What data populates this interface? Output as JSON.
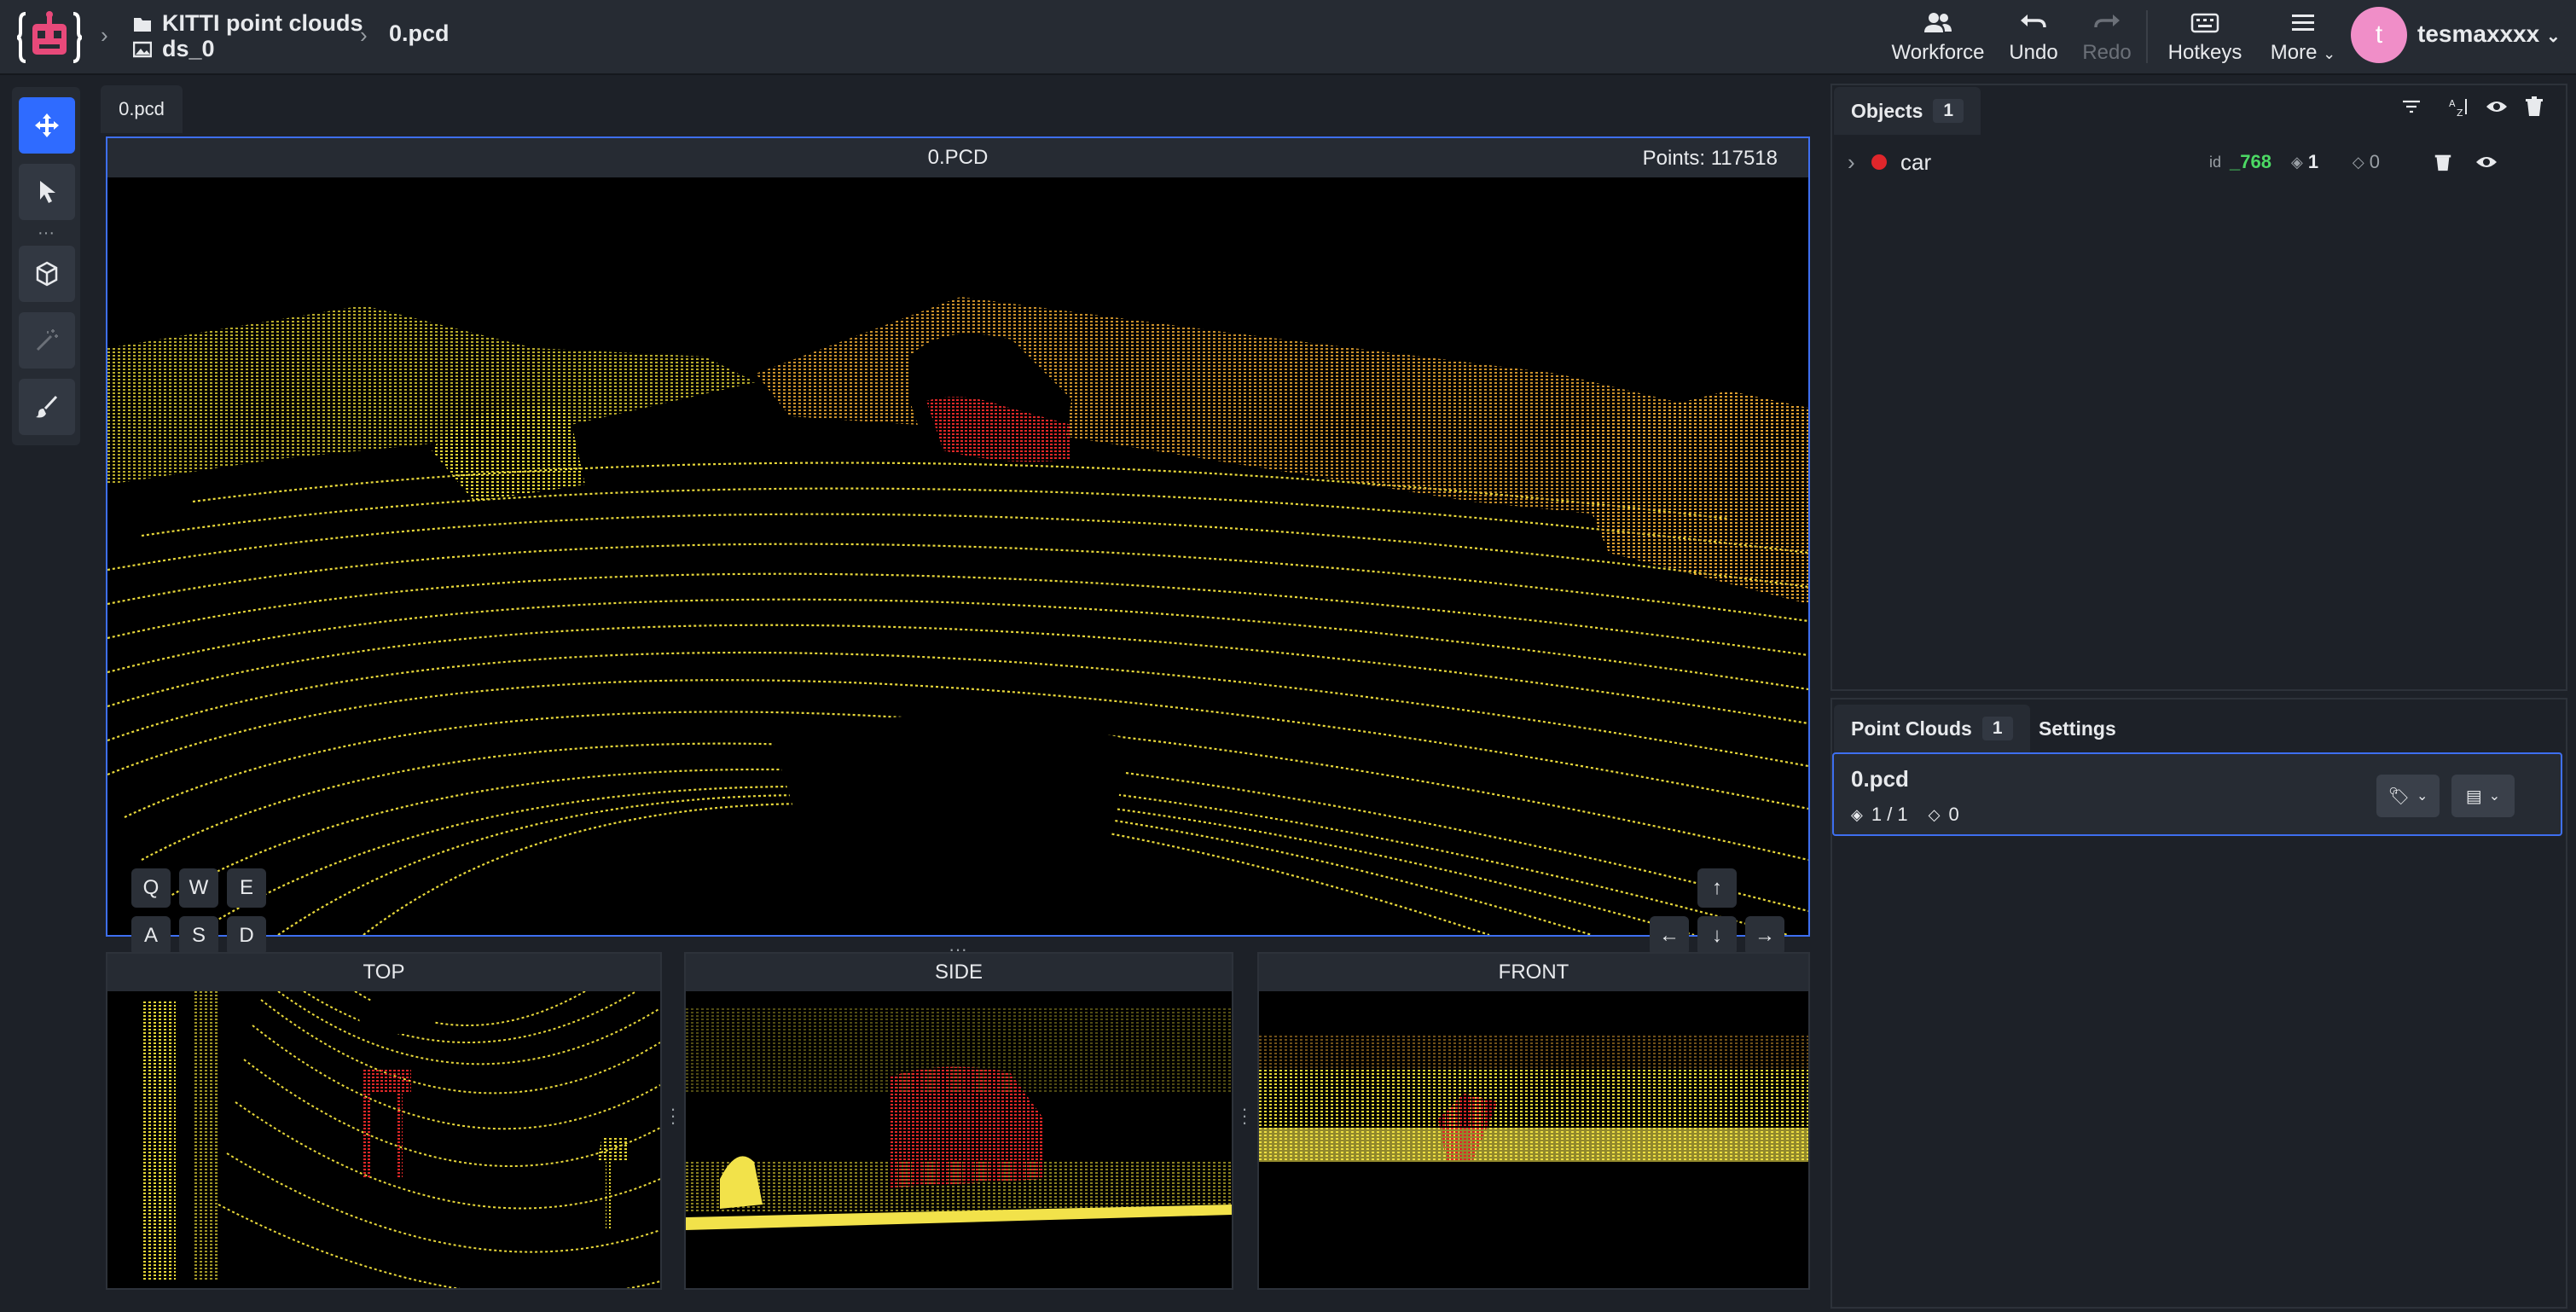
{
  "breadcrumb": {
    "project": "KITTI point clouds",
    "dataset": "ds_0",
    "file": "0.pcd"
  },
  "toolbar": {
    "workforce": "Workforce",
    "undo": "Undo",
    "redo": "Redo",
    "hotkeys": "Hotkeys",
    "more": "More"
  },
  "user": {
    "initial": "t",
    "name": "tesmaxxxx"
  },
  "tools": [
    "move-icon",
    "pointer-icon",
    "cube-icon",
    "magic-wand-icon",
    "brush-icon"
  ],
  "tabs": {
    "file": "0.pcd"
  },
  "main_view": {
    "title": "0.PCD",
    "points": "Points: 117518"
  },
  "keys": {
    "row1": [
      "Q",
      "W",
      "E"
    ],
    "row2": [
      "A",
      "S",
      "D"
    ]
  },
  "sub_views": {
    "top": "TOP",
    "side": "SIDE",
    "front": "FRONT"
  },
  "objects_panel": {
    "tab_label": "Objects",
    "count": "1",
    "objects": [
      {
        "name": "car",
        "color": "#e0262b",
        "id_label": "id",
        "id": "_768",
        "layers": "1",
        "tags": "0"
      }
    ]
  },
  "pointclouds_panel": {
    "tab_label": "Point Clouds",
    "count": "1",
    "settings_tab": "Settings",
    "items": [
      {
        "name": "0.pcd",
        "layers": "1 / 1",
        "tags": "0"
      }
    ]
  },
  "colors": {
    "accent": "#2f6bff",
    "point_yellow": "#f0e03a",
    "point_red": "#e0262b",
    "id_green": "#4cd964"
  }
}
